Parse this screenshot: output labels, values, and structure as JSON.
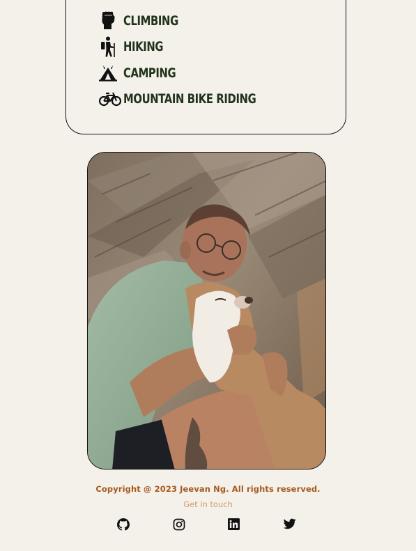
{
  "hobbies": [
    {
      "label": "CLIMBING",
      "icon": "fist-icon"
    },
    {
      "label": "HIKING",
      "icon": "hiker-icon"
    },
    {
      "label": "CAMPING",
      "icon": "tent-icon"
    },
    {
      "label": "MOUNTAIN BIKE RIDING",
      "icon": "bicycle-icon"
    }
  ],
  "photo": {
    "description_icon": "profile-photo"
  },
  "footer": {
    "copyright": "Copyright @ 2023 Jeevan Ng. All rights reserved.",
    "contact_link": "Get in touch",
    "social": [
      {
        "name": "github",
        "icon": "github-icon"
      },
      {
        "name": "instagram",
        "icon": "instagram-icon"
      },
      {
        "name": "linkedin",
        "icon": "linkedin-icon"
      },
      {
        "name": "twitter",
        "icon": "twitter-icon"
      }
    ]
  },
  "colors": {
    "background": "#f4f0ea",
    "hobby_text": "#20331c",
    "copyright_text": "#a55a1f",
    "link_text": "#d49a63",
    "border": "#111111"
  }
}
